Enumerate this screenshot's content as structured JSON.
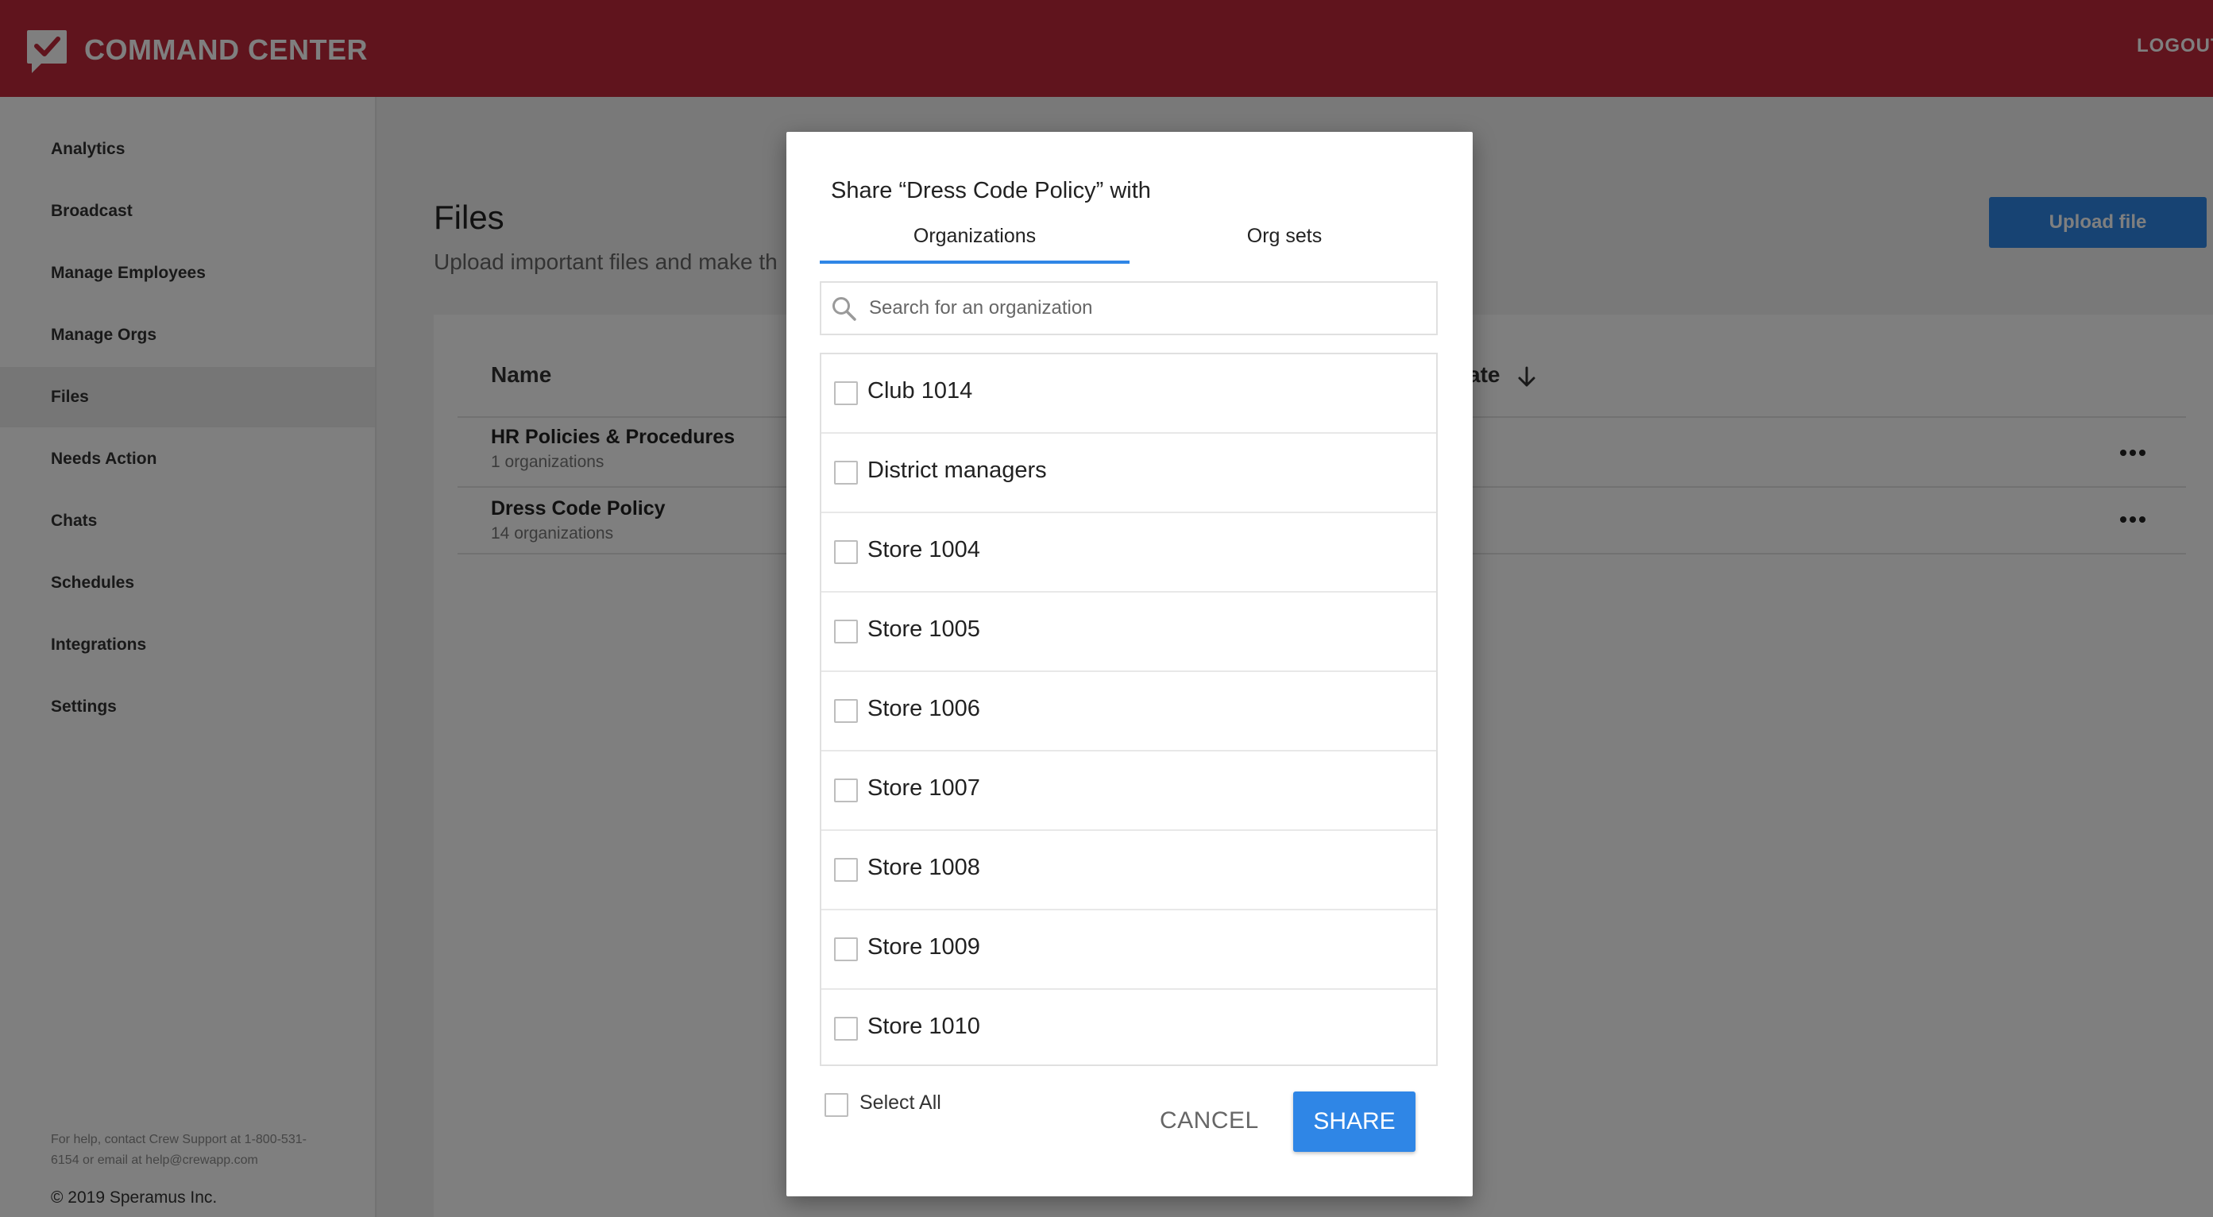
{
  "header": {
    "brand": "COMMAND CENTER",
    "logo_icon": "check-chat-icon",
    "logout_label": "LOGOUT"
  },
  "sidebar": {
    "items": [
      {
        "label": "Analytics"
      },
      {
        "label": "Broadcast"
      },
      {
        "label": "Manage Employees"
      },
      {
        "label": "Manage Orgs"
      },
      {
        "label": "Files",
        "active": true
      },
      {
        "label": "Needs Action"
      },
      {
        "label": "Chats"
      },
      {
        "label": "Schedules"
      },
      {
        "label": "Integrations"
      },
      {
        "label": "Settings"
      }
    ],
    "help_text": "For help, contact Crew Support at 1-800-531-6154 or email at help@crewapp.com",
    "copyright": "© 2019 Speramus Inc."
  },
  "main": {
    "title": "Files",
    "subtitle": "Upload important files and make th",
    "upload_label": "Upload file",
    "table": {
      "col_name": "Name",
      "col_date": "ate",
      "rows": [
        {
          "name": "HR Policies & Procedures",
          "orgs": "1 organizations"
        },
        {
          "name": "Dress Code Policy",
          "orgs": "14 organizations"
        }
      ]
    }
  },
  "modal": {
    "title": "Share “Dress Code Policy” with",
    "tabs": [
      {
        "label": "Organizations",
        "active": true
      },
      {
        "label": "Org sets"
      }
    ],
    "search_placeholder": "Search for an organization",
    "items": [
      {
        "label": "Club 1014",
        "checked": false
      },
      {
        "label": "District managers",
        "checked": false
      },
      {
        "label": "Store 1004",
        "checked": false
      },
      {
        "label": "Store 1005",
        "checked": false
      },
      {
        "label": "Store 1006",
        "checked": false
      },
      {
        "label": "Store 1007",
        "checked": false
      },
      {
        "label": "Store 1008",
        "checked": false
      },
      {
        "label": "Store 1009",
        "checked": false
      },
      {
        "label": "Store 1010",
        "checked": false
      }
    ],
    "select_all_label": "Select All",
    "cancel_label": "CANCEL",
    "share_label": "SHARE"
  },
  "colors": {
    "header_bg": "#c0283a",
    "accent_blue": "#2f86e6",
    "overlay": "rgba(0,0,0,0.5)"
  }
}
